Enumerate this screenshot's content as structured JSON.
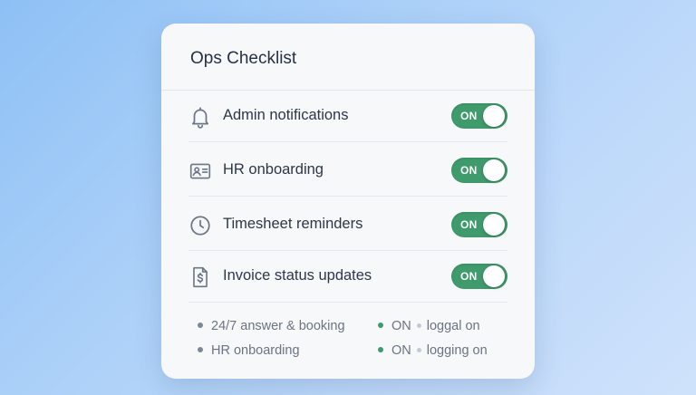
{
  "card": {
    "title": "Ops Checklist"
  },
  "settings": [
    {
      "label": "Admin notifications",
      "icon": "bell-icon",
      "toggle_text": "ON",
      "enabled": true
    },
    {
      "label": "HR onboarding",
      "icon": "id-card-icon",
      "toggle_text": "ON",
      "enabled": true
    },
    {
      "label": "Timesheet reminders",
      "icon": "clock-icon",
      "toggle_text": "ON",
      "enabled": true
    },
    {
      "label": "Invoice status updates",
      "icon": "invoice-dollar-icon",
      "toggle_text": "ON",
      "enabled": true
    }
  ],
  "footer": {
    "left": [
      {
        "text": "24/7 answer & booking"
      },
      {
        "text": "HR onboarding"
      }
    ],
    "right": [
      {
        "status": "ON",
        "detail": "loggal on"
      },
      {
        "status": "ON",
        "detail": "logging on"
      }
    ]
  },
  "colors": {
    "accent_green": "#3f9a6c",
    "card_background": "#f7f8fa",
    "text_primary": "#2c3747",
    "text_muted": "#6a7483"
  }
}
